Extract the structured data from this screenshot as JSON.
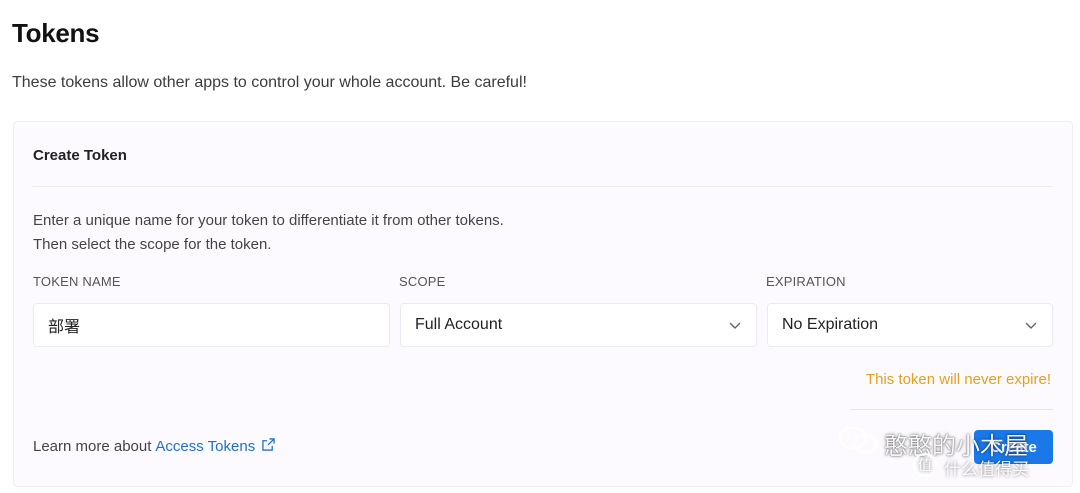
{
  "page": {
    "title": "Tokens",
    "description": "These tokens allow other apps to control your whole account. Be careful!"
  },
  "card": {
    "title": "Create Token",
    "help_line1": "Enter a unique name for your token to differentiate it from other tokens.",
    "help_line2": "Then select the scope for the token.",
    "fields": {
      "token_name": {
        "label": "TOKEN NAME",
        "value": "部署"
      },
      "scope": {
        "label": "SCOPE",
        "selected": "Full Account"
      },
      "expiration": {
        "label": "EXPIRATION",
        "selected": "No Expiration"
      }
    },
    "warning": "This token will never expire!",
    "learn_more_prefix": "Learn more about",
    "learn_more_link": "Access Tokens",
    "create_button": "Create"
  },
  "watermark": {
    "line1": "憨憨的小木屋",
    "line2": "什么值得买"
  },
  "colors": {
    "accent": "#1a78e8",
    "link": "#1f6fd1",
    "warning": "#e3a21a",
    "card_bg": "#fcfaff"
  }
}
